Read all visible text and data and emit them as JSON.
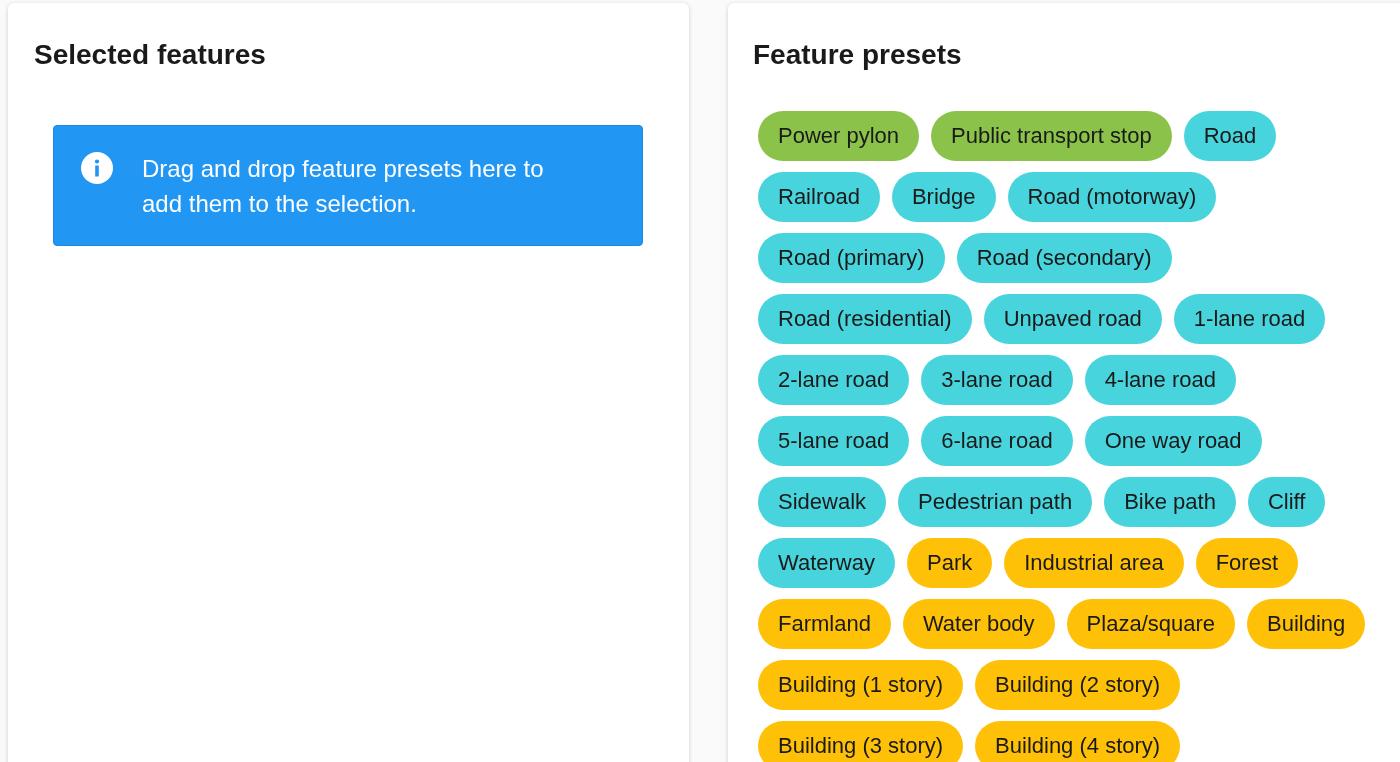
{
  "selected_panel": {
    "title": "Selected features",
    "info_message": "Drag and drop feature presets here to add them to the selection."
  },
  "presets_panel": {
    "title": "Feature presets",
    "presets": [
      {
        "label": "Power pylon",
        "color": "#8bc34a"
      },
      {
        "label": "Public transport stop",
        "color": "#8bc34a"
      },
      {
        "label": "Road",
        "color": "#48d4dc"
      },
      {
        "label": "Railroad",
        "color": "#48d4dc"
      },
      {
        "label": "Bridge",
        "color": "#48d4dc"
      },
      {
        "label": "Road (motorway)",
        "color": "#48d4dc"
      },
      {
        "label": "Road (primary)",
        "color": "#48d4dc"
      },
      {
        "label": "Road (secondary)",
        "color": "#48d4dc"
      },
      {
        "label": "Road (residential)",
        "color": "#48d4dc"
      },
      {
        "label": "Unpaved road",
        "color": "#48d4dc"
      },
      {
        "label": "1-lane road",
        "color": "#48d4dc"
      },
      {
        "label": "2-lane road",
        "color": "#48d4dc"
      },
      {
        "label": "3-lane road",
        "color": "#48d4dc"
      },
      {
        "label": "4-lane road",
        "color": "#48d4dc"
      },
      {
        "label": "5-lane road",
        "color": "#48d4dc"
      },
      {
        "label": "6-lane road",
        "color": "#48d4dc"
      },
      {
        "label": "One way road",
        "color": "#48d4dc"
      },
      {
        "label": "Sidewalk",
        "color": "#48d4dc"
      },
      {
        "label": "Pedestrian path",
        "color": "#48d4dc"
      },
      {
        "label": "Bike path",
        "color": "#48d4dc"
      },
      {
        "label": "Cliff",
        "color": "#48d4dc"
      },
      {
        "label": "Waterway",
        "color": "#48d4dc"
      },
      {
        "label": "Park",
        "color": "#ffc107"
      },
      {
        "label": "Industrial area",
        "color": "#ffc107"
      },
      {
        "label": "Forest",
        "color": "#ffc107"
      },
      {
        "label": "Farmland",
        "color": "#ffc107"
      },
      {
        "label": "Water body",
        "color": "#ffc107"
      },
      {
        "label": "Plaza/square",
        "color": "#ffc107"
      },
      {
        "label": "Building",
        "color": "#ffc107"
      },
      {
        "label": "Building (1 story)",
        "color": "#ffc107"
      },
      {
        "label": "Building (2 story)",
        "color": "#ffc107"
      },
      {
        "label": "Building (3 story)",
        "color": "#ffc107"
      },
      {
        "label": "Building (4 story)",
        "color": "#ffc107"
      }
    ]
  }
}
